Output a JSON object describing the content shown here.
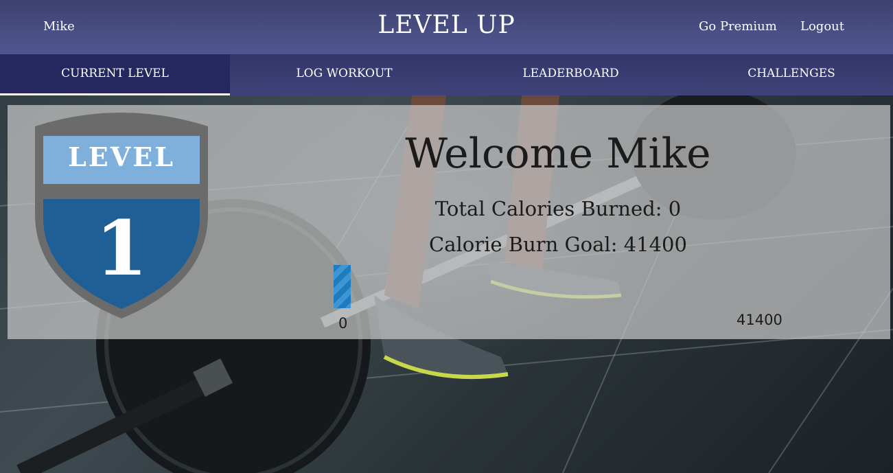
{
  "header": {
    "user_name": "Mike",
    "app_title": "LEVEL UP",
    "go_premium": "Go Premium",
    "logout": "Logout"
  },
  "nav": {
    "tabs": [
      {
        "label": "CURRENT LEVEL",
        "active": true
      },
      {
        "label": "LOG WORKOUT",
        "active": false
      },
      {
        "label": "LEADERBOARD",
        "active": false
      },
      {
        "label": "CHALLENGES",
        "active": false
      }
    ]
  },
  "level_badge": {
    "word": "LEVEL",
    "number": "1",
    "colors": {
      "rim": "#6b6b6b",
      "top": "#7fb0dc",
      "bottom": "#1f5f96"
    }
  },
  "main": {
    "welcome": "Welcome Mike",
    "total_calories": "Total Calories Burned: 0",
    "calorie_goal": "Calorie Burn Goal: 41400",
    "progress": {
      "current": 0,
      "goal": 41400,
      "min_label": "0",
      "max_label": "41400",
      "fill_color": "#1c7cc0"
    }
  },
  "colors": {
    "header": "#4a4f84",
    "nav": "#3e4278",
    "nav_active": "#25285e"
  }
}
